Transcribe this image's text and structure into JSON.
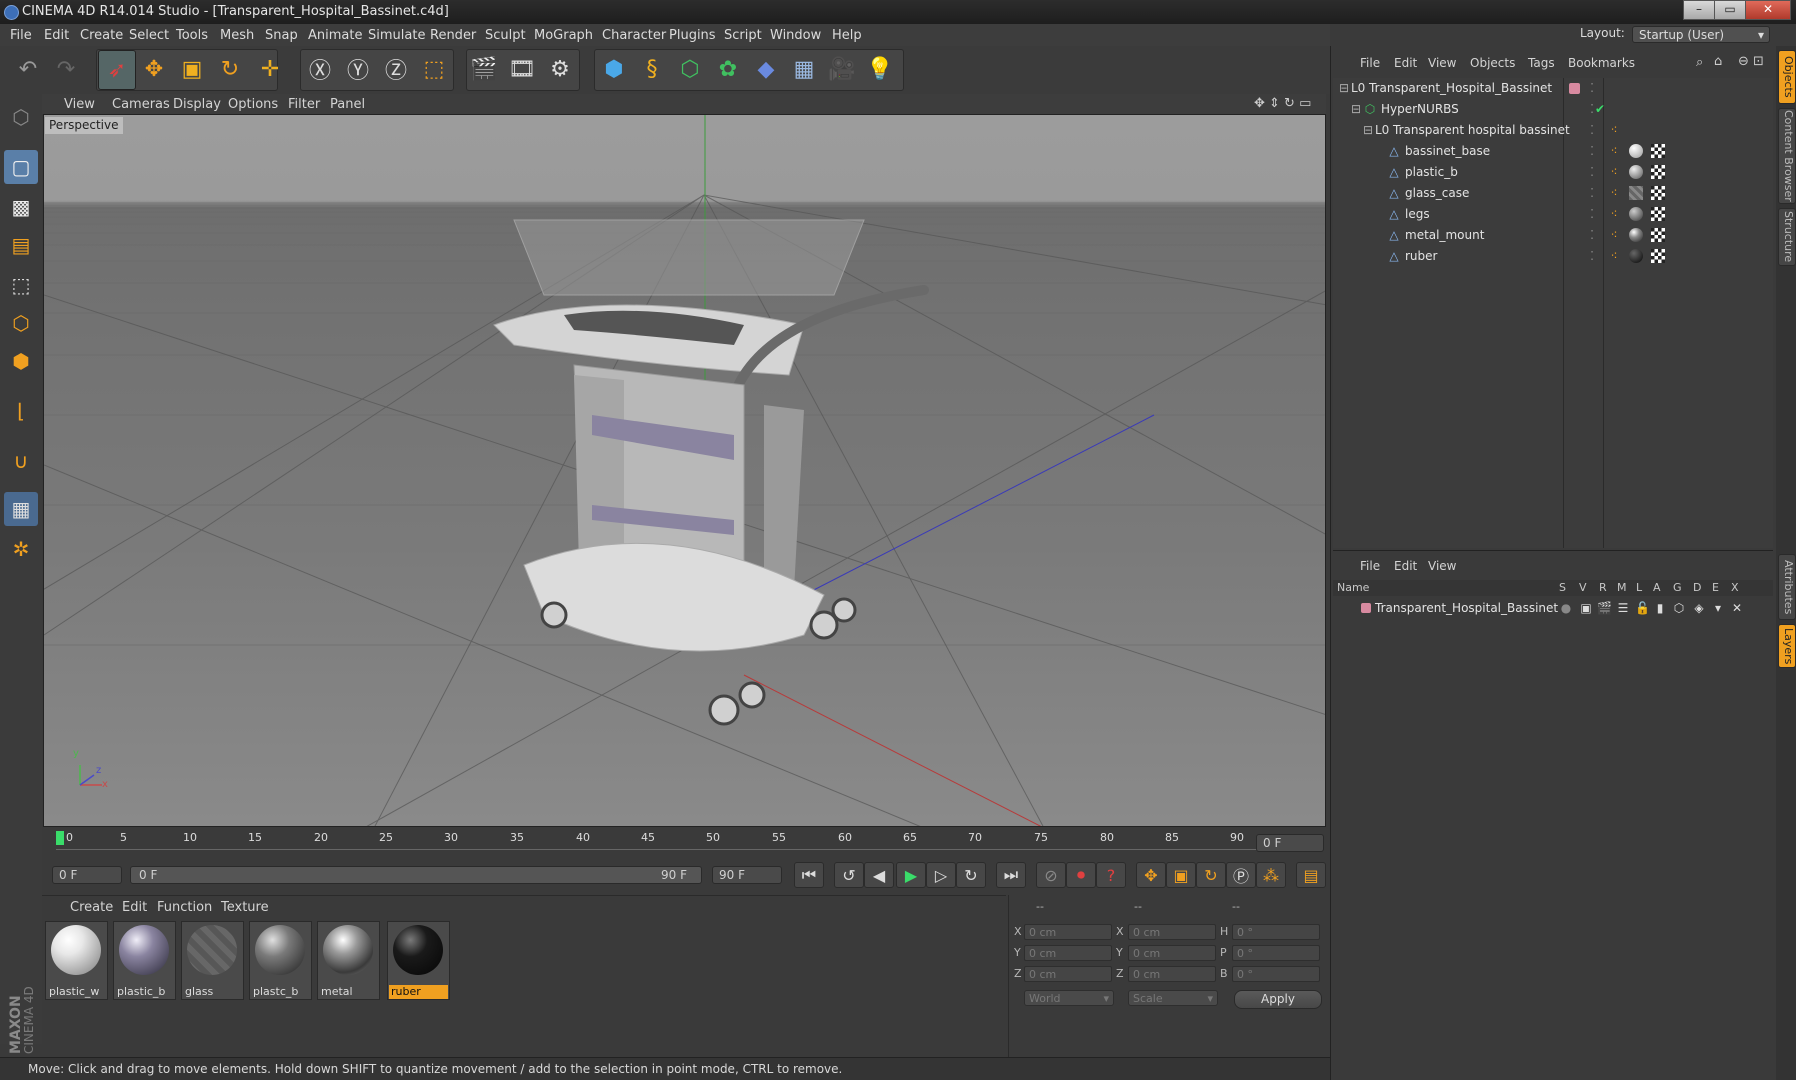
{
  "window": {
    "title": "CINEMA 4D R14.014 Studio - [Transparent_Hospital_Bassinet.c4d]",
    "controls": [
      "–",
      "▭",
      "✕"
    ]
  },
  "menubar": {
    "items": [
      "File",
      "Edit",
      "Create",
      "Select",
      "Tools",
      "Mesh",
      "Snap",
      "Animate",
      "Simulate",
      "Render",
      "Sculpt",
      "MoGraph",
      "Character",
      "Plugins",
      "Script",
      "Window",
      "Help"
    ],
    "layout_label": "Layout:",
    "layout_value": "Startup (User)"
  },
  "viewport": {
    "menu": [
      "View",
      "Cameras",
      "Display",
      "Options",
      "Filter",
      "Panel"
    ],
    "label": "Perspective",
    "axis": {
      "y": "y",
      "z": "z",
      "x": "x"
    }
  },
  "timeline": {
    "ticks": [
      "0",
      "5",
      "10",
      "15",
      "20",
      "25",
      "30",
      "35",
      "40",
      "45",
      "50",
      "55",
      "60",
      "65",
      "70",
      "75",
      "80",
      "85",
      "90"
    ],
    "current_frame": "0 F",
    "start_field": "0 F",
    "range_start": "0 F",
    "range_end": "90 F",
    "end_field": "90 F"
  },
  "material_manager": {
    "menu": [
      "Create",
      "Edit",
      "Function",
      "Texture"
    ],
    "materials": [
      {
        "name": "plastic_w",
        "color": "#e8e8e8"
      },
      {
        "name": "plastic_b",
        "color": "#8a84a0"
      },
      {
        "name": "glass",
        "color": "#6a6a6a"
      },
      {
        "name": "plastc_b",
        "color": "#7a7a7a"
      },
      {
        "name": "metal",
        "color": "#9a9a9a"
      },
      {
        "name": "ruber",
        "color": "#1a1a1a"
      }
    ],
    "selected": "ruber"
  },
  "coordinates": {
    "headers": [
      "--",
      "--",
      "--"
    ],
    "rows": [
      {
        "a_label": "X",
        "a_val": "0 cm",
        "b_label": "X",
        "b_val": "0 cm",
        "c_label": "H",
        "c_val": "0 °"
      },
      {
        "a_label": "Y",
        "a_val": "0 cm",
        "b_label": "Y",
        "b_val": "0 cm",
        "c_label": "P",
        "c_val": "0 °"
      },
      {
        "a_label": "Z",
        "a_val": "0 cm",
        "b_label": "Z",
        "b_val": "0 cm",
        "c_label": "B",
        "c_val": "0 °"
      }
    ],
    "space": "World",
    "mode": "Scale",
    "apply": "Apply"
  },
  "status": "Move: Click and drag to move elements. Hold down SHIFT to quantize movement / add to the selection in point mode, CTRL to remove.",
  "object_manager": {
    "menu": [
      "File",
      "Edit",
      "View",
      "Objects",
      "Tags",
      "Bookmarks"
    ],
    "objects": [
      {
        "name": "Transparent_Hospital_Bassinet",
        "depth": 0,
        "icon": "null"
      },
      {
        "name": "HyperNURBS",
        "depth": 1,
        "icon": "nurbs"
      },
      {
        "name": "Transparent hospital bassinet",
        "depth": 2,
        "icon": "null"
      },
      {
        "name": "bassinet_base",
        "depth": 3,
        "icon": "poly"
      },
      {
        "name": "plastic_b",
        "depth": 3,
        "icon": "poly"
      },
      {
        "name": "glass_case",
        "depth": 3,
        "icon": "poly"
      },
      {
        "name": "legs",
        "depth": 3,
        "icon": "poly"
      },
      {
        "name": "metal_mount",
        "depth": 3,
        "icon": "poly"
      },
      {
        "name": "ruber",
        "depth": 3,
        "icon": "poly"
      }
    ]
  },
  "layer_manager": {
    "menu": [
      "File",
      "Edit",
      "View"
    ],
    "columns": [
      "Name",
      "S",
      "V",
      "R",
      "M",
      "L",
      "A",
      "G",
      "D",
      "E",
      "X"
    ],
    "layers": [
      {
        "name": "Transparent_Hospital_Bassinet",
        "color": "#d88aa0"
      }
    ]
  },
  "side_tabs": [
    "Objects",
    "Content Browser",
    "Structure",
    "Attributes",
    "Layers"
  ],
  "branding": {
    "brand": "MAXON",
    "product": "CINEMA 4D"
  }
}
